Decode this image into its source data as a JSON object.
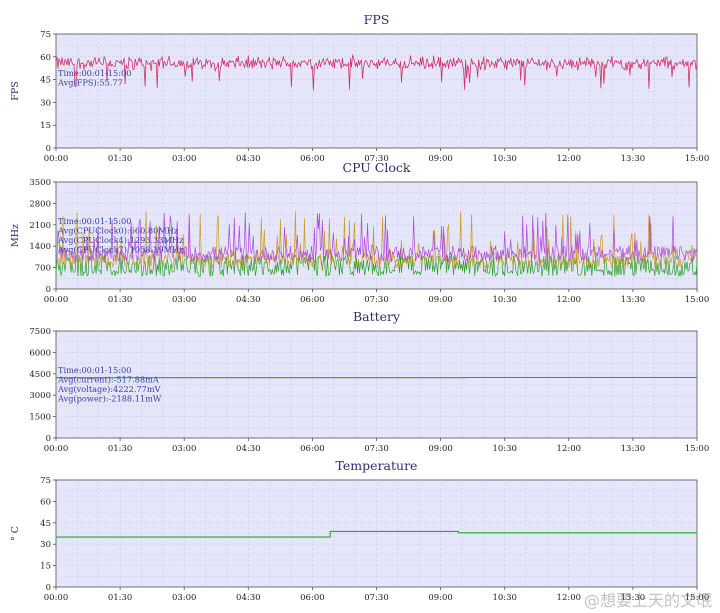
{
  "colors": {
    "plot_bg": "#e6e6fa",
    "grid": "#c8c8e0",
    "axis": "#505050",
    "title": "#2e2e6e",
    "annotation": "#3c3caa",
    "fps": "#d0346a",
    "cpu0": "#2ca02c",
    "cpu4": "#cc9a22",
    "cpu7": "#b04ad8",
    "battery": "#22aa22",
    "temperature": "#22aa22"
  },
  "watermark": "@想要上天的文氓",
  "chart_data": [
    {
      "type": "line",
      "title": "FPS",
      "ylabel": "FPS",
      "ylim": [
        0,
        75
      ],
      "yticks": [
        "0",
        "15",
        "30",
        "45",
        "60",
        "75"
      ],
      "xticks": [
        "00:00",
        "01:30",
        "03:00",
        "04:30",
        "06:00",
        "07:30",
        "09:00",
        "10:30",
        "12:00",
        "13:30",
        "15:00"
      ],
      "xlim_minutes": [
        0,
        900
      ],
      "grid": true,
      "annotation": [
        "Time:00:01-15:00",
        "Avg(FPS):55.77"
      ],
      "series": [
        {
          "color_key": "fps",
          "base": 55.8,
          "noise": 4,
          "spike_min": 38,
          "spike_chance": 0.05,
          "x": [
            0,
            900
          ],
          "y": [
            55.8,
            55.8
          ]
        }
      ]
    },
    {
      "type": "line",
      "title": "CPU Clock",
      "ylabel": "MHz",
      "ylim": [
        0,
        3500
      ],
      "yticks": [
        "0",
        "700",
        "1400",
        "2100",
        "2800",
        "3500"
      ],
      "xticks": [
        "00:00",
        "01:30",
        "03:00",
        "04:30",
        "06:00",
        "07:30",
        "09:00",
        "10:30",
        "12:00",
        "13:30",
        "15:00"
      ],
      "xlim_minutes": [
        0,
        900
      ],
      "grid": true,
      "annotation": [
        "Time:00:01-15:00",
        "Avg(CPUClock0):660.80MHz",
        "Avg(CPUClock4):1293.33MHz",
        "Avg(CPUClock7):1058.39MHz"
      ],
      "series": [
        {
          "color_key": "cpu0",
          "low": 400,
          "high": 1100
        },
        {
          "color_key": "cpu4",
          "low": 700,
          "high": 2600
        },
        {
          "color_key": "cpu7",
          "low": 900,
          "high": 2500
        }
      ]
    },
    {
      "type": "line",
      "title": "Battery",
      "ylabel": "",
      "ylim": [
        0,
        7500
      ],
      "yticks": [
        "0",
        "1500",
        "3000",
        "4500",
        "6000",
        "7500"
      ],
      "xticks": [
        "00:00",
        "01:30",
        "03:00",
        "04:30",
        "06:00",
        "07:30",
        "09:00",
        "10:30",
        "12:00",
        "13:30",
        "15:00"
      ],
      "xlim_minutes": [
        0,
        900
      ],
      "grid": true,
      "annotation": [
        "Time:00:01-15:00",
        "Avg(current):-517.88mA",
        "Avg(voltage):4222.77mV",
        "Avg(power):-2188.11mW"
      ],
      "series": [
        {
          "color_key": "battery",
          "x": [
            0,
            575,
            575,
            900
          ],
          "y": [
            4230,
            4230,
            4240,
            4240
          ]
        }
      ]
    },
    {
      "type": "line",
      "title": "Temperature",
      "ylabel": "° C",
      "ylim": [
        0,
        75
      ],
      "yticks": [
        "0",
        "15",
        "30",
        "45",
        "60",
        "75"
      ],
      "xticks": [
        "00:00",
        "01:30",
        "03:00",
        "04:30",
        "06:00",
        "07:30",
        "09:00",
        "10:30",
        "12:00",
        "13:30",
        "15:00"
      ],
      "xlim_minutes": [
        0,
        900
      ],
      "grid": true,
      "annotation": [],
      "series": [
        {
          "color_key": "temperature",
          "x": [
            0,
            385,
            385,
            565,
            565,
            900
          ],
          "y": [
            35,
            35,
            39,
            39,
            38,
            38
          ]
        }
      ]
    }
  ]
}
